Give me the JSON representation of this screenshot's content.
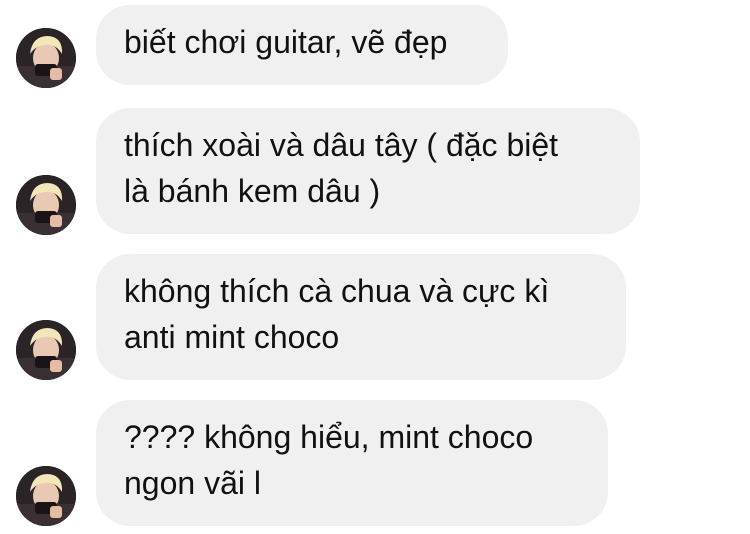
{
  "messages": [
    {
      "sender": "contact",
      "text": "biết chơi guitar, vẽ đẹp"
    },
    {
      "sender": "contact",
      "text": "thích xoài và dâu tây ( đặc biệt\nlà bánh kem dâu )"
    },
    {
      "sender": "contact",
      "text": "không thích cà chua và cực kì\nanti mint choco"
    },
    {
      "sender": "contact",
      "text": "???? không hiểu, mint choco\nngon vãi l"
    }
  ],
  "colors": {
    "bubble_background": "#f0f0f0",
    "text": "#111111",
    "page_background": "#ffffff"
  },
  "icons": {
    "avatar": "contact-avatar-photo"
  }
}
